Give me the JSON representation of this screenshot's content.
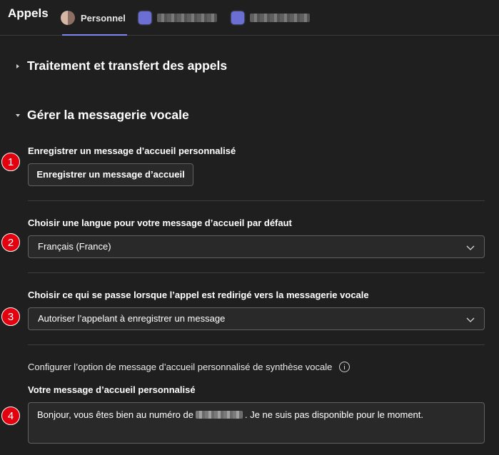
{
  "header": {
    "title": "Appels",
    "tabs": [
      {
        "label": "Personnel",
        "selected": true
      },
      {
        "label": "",
        "selected": false
      },
      {
        "label": "",
        "selected": false
      }
    ]
  },
  "sections": {
    "traitement": {
      "title": "Traitement et transfert des appels",
      "expanded": false
    },
    "gerer": {
      "title": "Gérer la messagerie vocale",
      "expanded": true
    }
  },
  "voicemail": {
    "record": {
      "label": "Enregistrer un message d’accueil personnalisé",
      "button": "Enregistrer un message d’accueil"
    },
    "language": {
      "label": "Choisir une langue pour votre message d’accueil par défaut",
      "value": "Français (France)"
    },
    "redirect": {
      "label": "Choisir ce qui se passe lorsque l’appel est redirigé vers la messagerie vocale",
      "value": "Autoriser l’appelant à enregistrer un message"
    },
    "tts": {
      "label": "Configurer l’option de message d’accueil personnalisé de synthèse vocale",
      "greeting_label": "Votre message d’accueil personnalisé",
      "greeting_before": "Bonjour, vous êtes bien au numéro de",
      "greeting_after": ". Je ne suis pas disponible pour le moment."
    }
  },
  "markers": [
    "1",
    "2",
    "3",
    "4"
  ],
  "colors": {
    "background": "#1f1f1f",
    "accent": "#7f85f5",
    "marker": "#e3000f"
  }
}
